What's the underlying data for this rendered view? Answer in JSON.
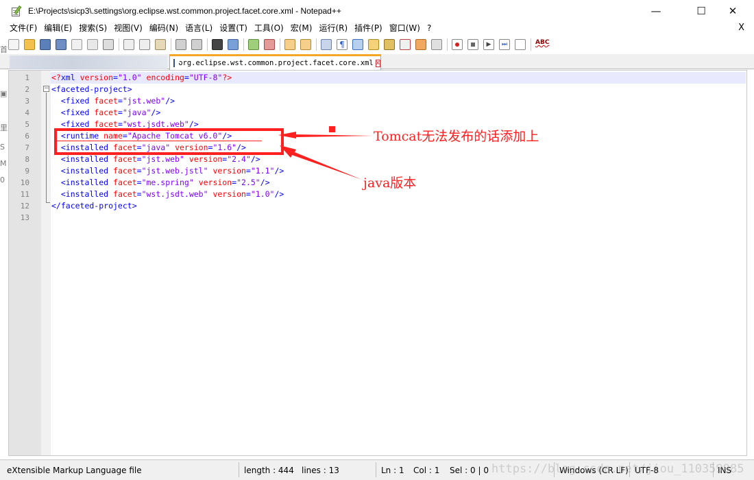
{
  "window": {
    "title": "E:\\Projects\\sicp3\\.settings\\org.eclipse.wst.common.project.facet.core.xml - Notepad++",
    "minimize": "—",
    "maximize": "☐",
    "close": "✕"
  },
  "menu": {
    "items": [
      "文件(F)",
      "编辑(E)",
      "搜索(S)",
      "视图(V)",
      "编码(N)",
      "语言(L)",
      "设置(T)",
      "工具(O)",
      "宏(M)",
      "运行(R)",
      "插件(P)",
      "窗口(W)",
      "?"
    ],
    "close_doc": "X"
  },
  "toolbar": {
    "spell_label": "ABC"
  },
  "tab": {
    "label": "org.eclipse.wst.common.project.facet.core.xml",
    "close": "x"
  },
  "editor": {
    "lines": [
      [
        {
          "t": "pi",
          "v": "<?"
        },
        {
          "t": "tag",
          "v": "xml "
        },
        {
          "t": "attr",
          "v": "version"
        },
        {
          "t": "tag",
          "v": "="
        },
        {
          "t": "val",
          "v": "\"1.0\""
        },
        {
          "t": "tag",
          "v": " "
        },
        {
          "t": "attr",
          "v": "encoding"
        },
        {
          "t": "tag",
          "v": "="
        },
        {
          "t": "val",
          "v": "\"UTF-8\""
        },
        {
          "t": "pi",
          "v": "?>"
        }
      ],
      [
        {
          "t": "tag",
          "v": "<faceted-project>"
        }
      ],
      [
        {
          "t": "tag",
          "v": "  <fixed "
        },
        {
          "t": "attr",
          "v": "facet"
        },
        {
          "t": "tag",
          "v": "="
        },
        {
          "t": "val",
          "v": "\"jst.web\""
        },
        {
          "t": "tag",
          "v": "/>"
        }
      ],
      [
        {
          "t": "tag",
          "v": "  <fixed "
        },
        {
          "t": "attr",
          "v": "facet"
        },
        {
          "t": "tag",
          "v": "="
        },
        {
          "t": "val",
          "v": "\"java\""
        },
        {
          "t": "tag",
          "v": "/>"
        }
      ],
      [
        {
          "t": "tag",
          "v": "  <fixed "
        },
        {
          "t": "attr",
          "v": "facet"
        },
        {
          "t": "tag",
          "v": "="
        },
        {
          "t": "val",
          "v": "\"wst.jsdt.web\""
        },
        {
          "t": "tag",
          "v": "/>"
        }
      ],
      [
        {
          "t": "tag",
          "v": "  <runtime "
        },
        {
          "t": "attr",
          "v": "name"
        },
        {
          "t": "tag",
          "v": "="
        },
        {
          "t": "val",
          "v": "\"Apache Tomcat v6.0\""
        },
        {
          "t": "tag",
          "v": "/>"
        }
      ],
      [
        {
          "t": "tag",
          "v": "  <installed "
        },
        {
          "t": "attr",
          "v": "facet"
        },
        {
          "t": "tag",
          "v": "="
        },
        {
          "t": "val",
          "v": "\"java\""
        },
        {
          "t": "tag",
          "v": " "
        },
        {
          "t": "attr",
          "v": "version"
        },
        {
          "t": "tag",
          "v": "="
        },
        {
          "t": "val",
          "v": "\"1.6\""
        },
        {
          "t": "tag",
          "v": "/>"
        }
      ],
      [
        {
          "t": "tag",
          "v": "  <installed "
        },
        {
          "t": "attr",
          "v": "facet"
        },
        {
          "t": "tag",
          "v": "="
        },
        {
          "t": "val",
          "v": "\"jst.web\""
        },
        {
          "t": "tag",
          "v": " "
        },
        {
          "t": "attr",
          "v": "version"
        },
        {
          "t": "tag",
          "v": "="
        },
        {
          "t": "val",
          "v": "\"2.4\""
        },
        {
          "t": "tag",
          "v": "/>"
        }
      ],
      [
        {
          "t": "tag",
          "v": "  <installed "
        },
        {
          "t": "attr",
          "v": "facet"
        },
        {
          "t": "tag",
          "v": "="
        },
        {
          "t": "val",
          "v": "\"jst.web.jstl\""
        },
        {
          "t": "tag",
          "v": " "
        },
        {
          "t": "attr",
          "v": "version"
        },
        {
          "t": "tag",
          "v": "="
        },
        {
          "t": "val",
          "v": "\"1.1\""
        },
        {
          "t": "tag",
          "v": "/>"
        }
      ],
      [
        {
          "t": "tag",
          "v": "  <installed "
        },
        {
          "t": "attr",
          "v": "facet"
        },
        {
          "t": "tag",
          "v": "="
        },
        {
          "t": "val",
          "v": "\"me.spring\""
        },
        {
          "t": "tag",
          "v": " "
        },
        {
          "t": "attr",
          "v": "version"
        },
        {
          "t": "tag",
          "v": "="
        },
        {
          "t": "val",
          "v": "\"2.5\""
        },
        {
          "t": "tag",
          "v": "/>"
        }
      ],
      [
        {
          "t": "tag",
          "v": "  <installed "
        },
        {
          "t": "attr",
          "v": "facet"
        },
        {
          "t": "tag",
          "v": "="
        },
        {
          "t": "val",
          "v": "\"wst.jsdt.web\""
        },
        {
          "t": "tag",
          "v": " "
        },
        {
          "t": "attr",
          "v": "version"
        },
        {
          "t": "tag",
          "v": "="
        },
        {
          "t": "val",
          "v": "\"1.0\""
        },
        {
          "t": "tag",
          "v": "/>"
        }
      ],
      [
        {
          "t": "tag",
          "v": "</faceted-project>"
        }
      ],
      []
    ],
    "line_numbers": [
      "1",
      "2",
      "3",
      "4",
      "5",
      "6",
      "7",
      "8",
      "9",
      "10",
      "11",
      "12",
      "13"
    ]
  },
  "annotations": {
    "tomcat_note": "Tomcat无法发布的话添加上",
    "java_note": "java版本",
    "color": "#ff2020"
  },
  "status": {
    "file_type": "eXtensible Markup Language file",
    "length": "length : 444",
    "lines": "lines : 13",
    "ln": "Ln : 1",
    "col": "Col : 1",
    "sel": "Sel : 0 | 0",
    "eol": "Windows (CR LF)",
    "encoding": "UTF-8",
    "mode": "INS"
  },
  "watermark": "https://blog.csdn.net/jiou_110359985"
}
